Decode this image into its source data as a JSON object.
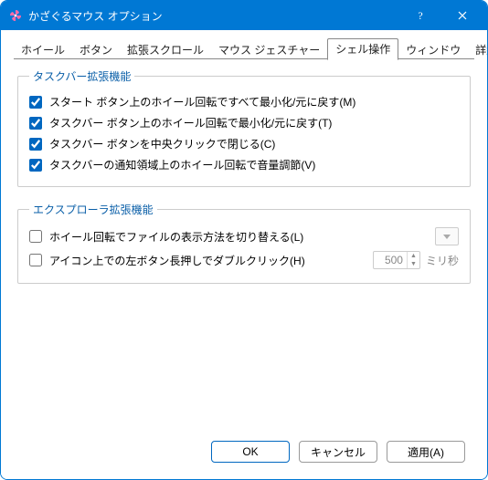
{
  "window": {
    "title": "かざぐるマウス オプション"
  },
  "tabs": {
    "t0": "ホイール",
    "t1": "ボタン",
    "t2": "拡張スクロール",
    "t3": "マウス ジェスチャー",
    "t4": "シェル操作",
    "t5": "ウィンドウ",
    "t6": "詳細"
  },
  "group1": {
    "legend": "タスクバー拡張機能",
    "opt0": "スタート ボタン上のホイール回転ですべて最小化/元に戻す(M)",
    "opt1": "タスクバー ボタン上のホイール回転で最小化/元に戻す(T)",
    "opt2": "タスクバー ボタンを中央クリックで閉じる(C)",
    "opt3": "タスクバーの通知領域上のホイール回転で音量調節(V)"
  },
  "group2": {
    "legend": "エクスプローラ拡張機能",
    "opt0": "ホイール回転でファイルの表示方法を切り替える(L)",
    "opt1": "アイコン上での左ボタン長押しでダブルクリック(H)",
    "spin_value": "500",
    "spin_suffix": "ミリ秒"
  },
  "buttons": {
    "ok": "OK",
    "cancel": "キャンセル",
    "apply": "適用(A)"
  }
}
